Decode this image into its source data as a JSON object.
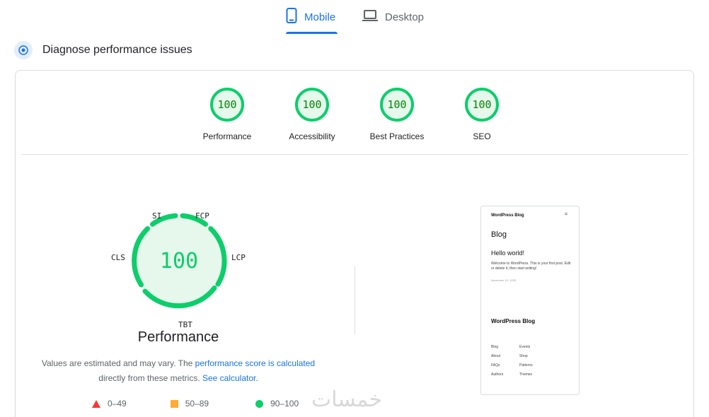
{
  "tabs": {
    "mobile": "Mobile",
    "desktop": "Desktop"
  },
  "header": {
    "title": "Diagnose performance issues"
  },
  "categories": [
    {
      "score": "100",
      "label": "Performance"
    },
    {
      "score": "100",
      "label": "Accessibility"
    },
    {
      "score": "100",
      "label": "Best Practices"
    },
    {
      "score": "100",
      "label": "SEO"
    }
  ],
  "main_gauge": {
    "score": "100",
    "title": "Performance",
    "metrics": {
      "si": "SI",
      "fcp": "FCP",
      "lcp": "LCP",
      "tbt": "TBT",
      "cls": "CLS"
    }
  },
  "note": {
    "text1": "Values are estimated and may vary. The ",
    "link1": "performance score is calculated",
    "text2": "directly from these metrics. ",
    "link2": "See calculator."
  },
  "legend": {
    "fail": "0–49",
    "average": "50–89",
    "pass": "90–100"
  },
  "colors": {
    "pass": "#0cce6b",
    "average": "#ffaa33",
    "fail": "#ff3333",
    "accent": "#1a73e8"
  },
  "screenshot": {
    "site_title": "WordPress Blog",
    "menu_icon": "=",
    "page_title": "Blog",
    "post_title": "Hello world!",
    "excerpt": "Welcome to WordPress. This is your first post. Edit or delete it, then start writing!",
    "date": "November 10, 2025",
    "footer_title": "WordPress Blog",
    "links_col1": [
      "Blog",
      "About",
      "FAQs",
      "Authors"
    ],
    "links_col2": [
      "Events",
      "Shop",
      "Patterns",
      "Themes"
    ]
  },
  "watermark": "خمسات"
}
